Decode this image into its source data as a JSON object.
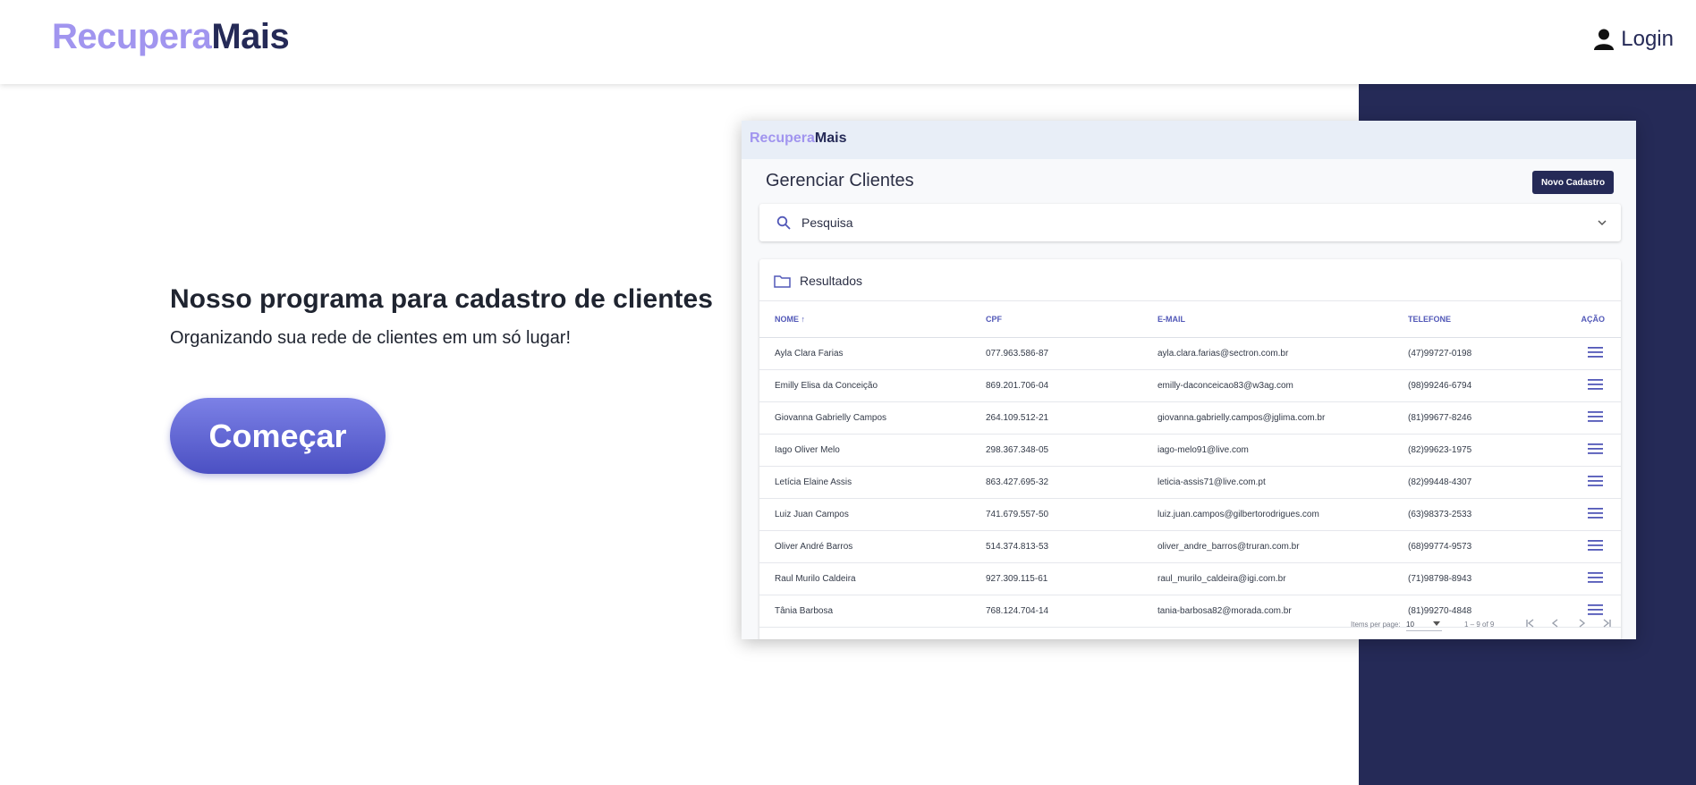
{
  "header": {
    "brand_part1": "Recupera",
    "brand_part2": "Mais",
    "login_label": "Login",
    "login_icon": "person-icon"
  },
  "hero": {
    "title": "Nosso programa para cadastro de clientes",
    "subtitle": "Organizando sua rede de clientes em um só lugar!",
    "cta_label": "Começar"
  },
  "preview": {
    "brand_part1": "Recupera",
    "brand_part2": "Mais",
    "page_title": "Gerenciar Clientes",
    "new_button": "Novo Cadastro",
    "search_label": "Pesquisa",
    "results_label": "Resultados",
    "columns": [
      "NOME",
      "CPF",
      "E-MAIL",
      "TELEFONE",
      "AÇÃO"
    ],
    "rows": [
      {
        "name": "Ayla Clara Farias",
        "cpf": "077.963.586-87",
        "email": "ayla.clara.farias@sectron.com.br",
        "phone": "(47)99727-0198"
      },
      {
        "name": "Emilly Elisa da Conceição",
        "cpf": "869.201.706-04",
        "email": "emilly-daconceicao83@w3ag.com",
        "phone": "(98)99246-6794"
      },
      {
        "name": "Giovanna Gabrielly Campos",
        "cpf": "264.109.512-21",
        "email": "giovanna.gabrielly.campos@jglima.com.br",
        "phone": "(81)99677-8246"
      },
      {
        "name": "Iago Oliver Melo",
        "cpf": "298.367.348-05",
        "email": "iago-melo91@live.com",
        "phone": "(82)99623-1975"
      },
      {
        "name": "Letícia Elaine Assis",
        "cpf": "863.427.695-32",
        "email": "leticia-assis71@live.com.pt",
        "phone": "(82)99448-4307"
      },
      {
        "name": "Luiz Juan Campos",
        "cpf": "741.679.557-50",
        "email": "luiz.juan.campos@gilbertorodrigues.com",
        "phone": "(63)98373-2533"
      },
      {
        "name": "Oliver André Barros",
        "cpf": "514.374.813-53",
        "email": "oliver_andre_barros@truran.com.br",
        "phone": "(68)99774-9573"
      },
      {
        "name": "Raul Murilo Caldeira",
        "cpf": "927.309.115-61",
        "email": "raul_murilo_caldeira@igi.com.br",
        "phone": "(71)98798-8943"
      },
      {
        "name": "Tânia Barbosa",
        "cpf": "768.124.704-14",
        "email": "tania-barbosa82@morada.com.br",
        "phone": "(81)99270-4848"
      }
    ],
    "pagination": {
      "items_per_page_label": "Items per page:",
      "items_per_page_value": "10",
      "range": "1 – 9 of 9"
    }
  },
  "colors": {
    "brand_light": "#a195ef",
    "brand_dark": "#252a57",
    "accent_blue": "#5258b8"
  }
}
